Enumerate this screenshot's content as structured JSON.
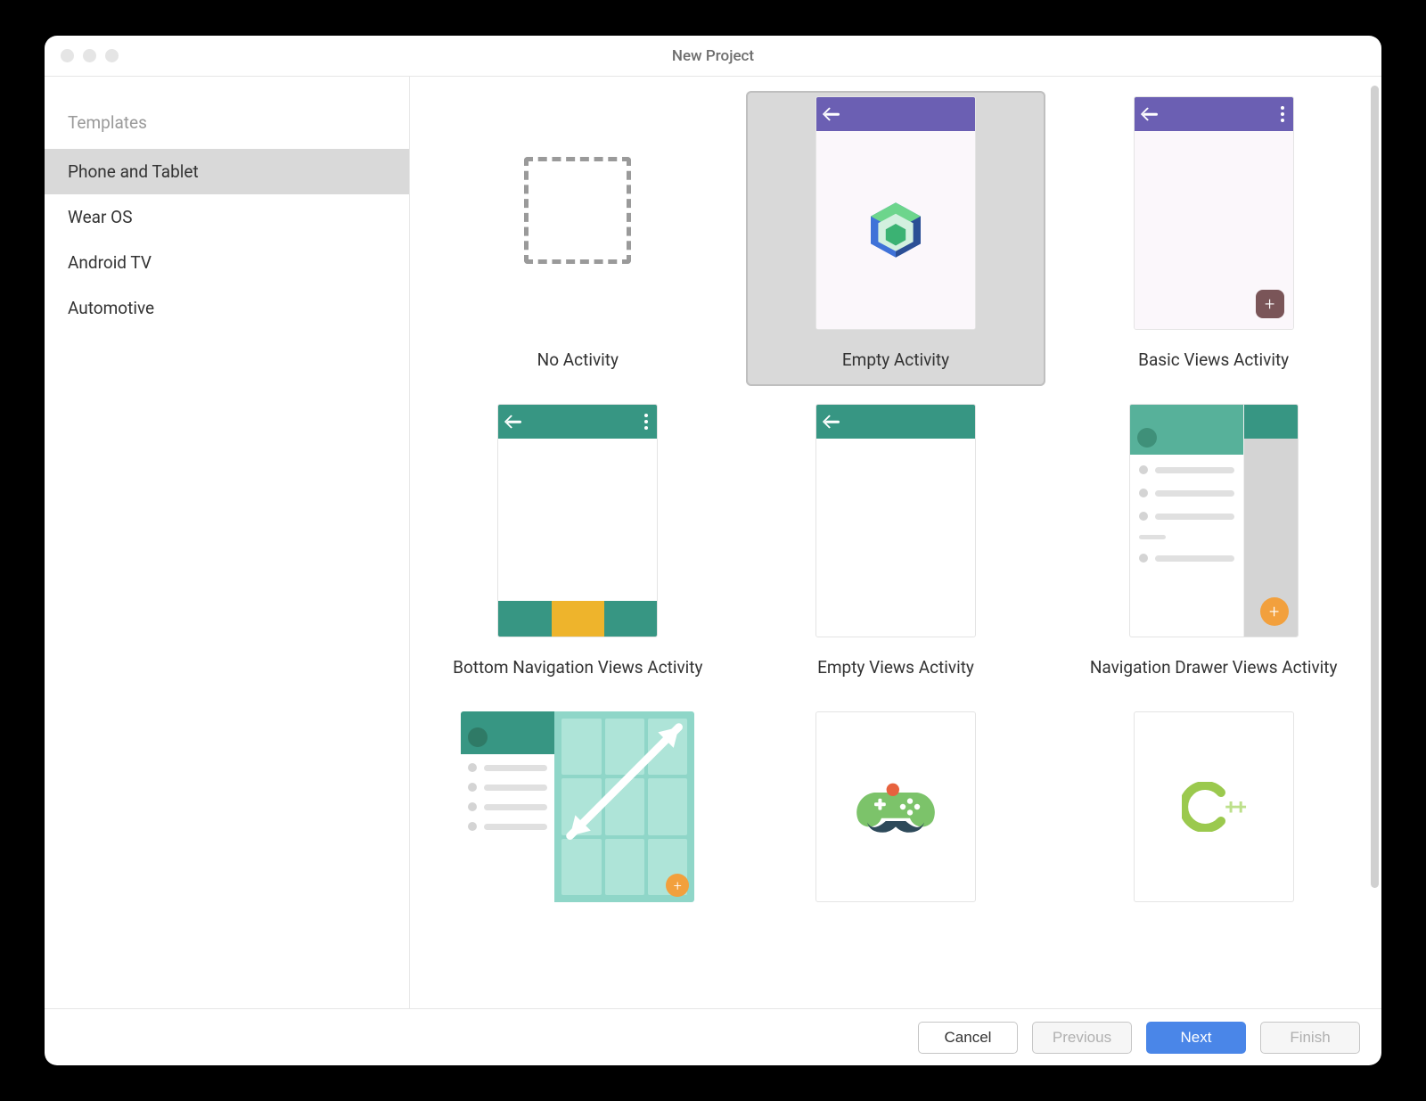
{
  "window": {
    "title": "New Project"
  },
  "sidebar": {
    "header": "Templates",
    "items": [
      {
        "label": "Phone and Tablet",
        "selected": true
      },
      {
        "label": "Wear OS",
        "selected": false
      },
      {
        "label": "Android TV",
        "selected": false
      },
      {
        "label": "Automotive",
        "selected": false
      }
    ]
  },
  "templates": [
    {
      "label": "No Activity",
      "kind": "none",
      "selected": false
    },
    {
      "label": "Empty Activity",
      "kind": "compose",
      "selected": true
    },
    {
      "label": "Basic Views Activity",
      "kind": "basic",
      "selected": false
    },
    {
      "label": "Bottom Navigation Views Activity",
      "kind": "bottomnav",
      "selected": false
    },
    {
      "label": "Empty Views Activity",
      "kind": "emptyviews",
      "selected": false
    },
    {
      "label": "Navigation Drawer Views Activity",
      "kind": "navdrawer",
      "selected": false
    },
    {
      "label": "",
      "kind": "responsive",
      "selected": false
    },
    {
      "label": "",
      "kind": "game",
      "selected": false
    },
    {
      "label": "",
      "kind": "cpp",
      "selected": false
    }
  ],
  "footer": {
    "cancel": "Cancel",
    "previous": "Previous",
    "next": "Next",
    "finish": "Finish"
  }
}
